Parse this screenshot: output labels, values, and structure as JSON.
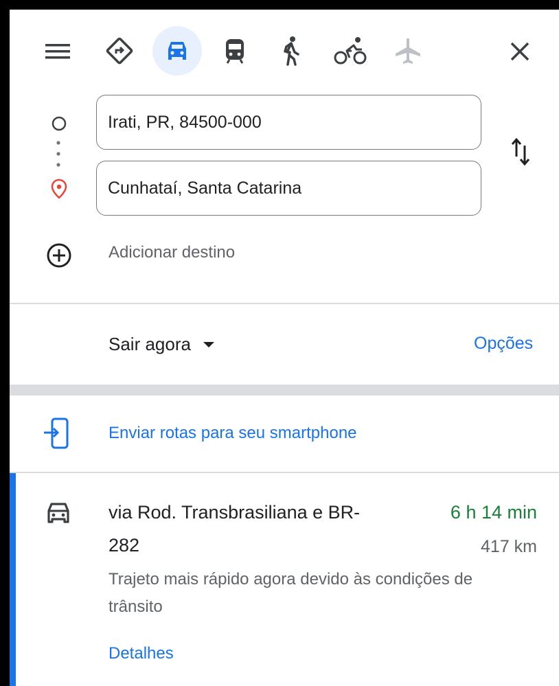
{
  "modes": [
    {
      "name": "best-route-icon",
      "active": false
    },
    {
      "name": "car-icon",
      "active": true
    },
    {
      "name": "transit-icon",
      "active": false
    },
    {
      "name": "walk-icon",
      "active": false
    },
    {
      "name": "bicycle-icon",
      "active": false
    },
    {
      "name": "flight-icon",
      "active": false
    }
  ],
  "origin": {
    "value": "Irati, PR, 84500-000"
  },
  "destination": {
    "value": "Cunhataí, Santa Catarina"
  },
  "add_destination": "Adicionar destino",
  "depart": {
    "label": "Sair agora"
  },
  "options": "Opções",
  "send_to_phone": "Enviar rotas para seu smartphone",
  "route": {
    "title_line1": "via Rod. Transbrasiliana e BR-",
    "title_line2": "282",
    "duration": "6 h 14 min",
    "distance": "417 km",
    "note_line1": "Trajeto mais rápido agora devido às condições de",
    "note_line2": "trânsito",
    "details": "Detalhes"
  },
  "colors": {
    "accent": "#1a73e8",
    "duration_green": "#188038",
    "active_mode_bg": "#e8f0fe",
    "destination_pin": "#ea4335"
  }
}
